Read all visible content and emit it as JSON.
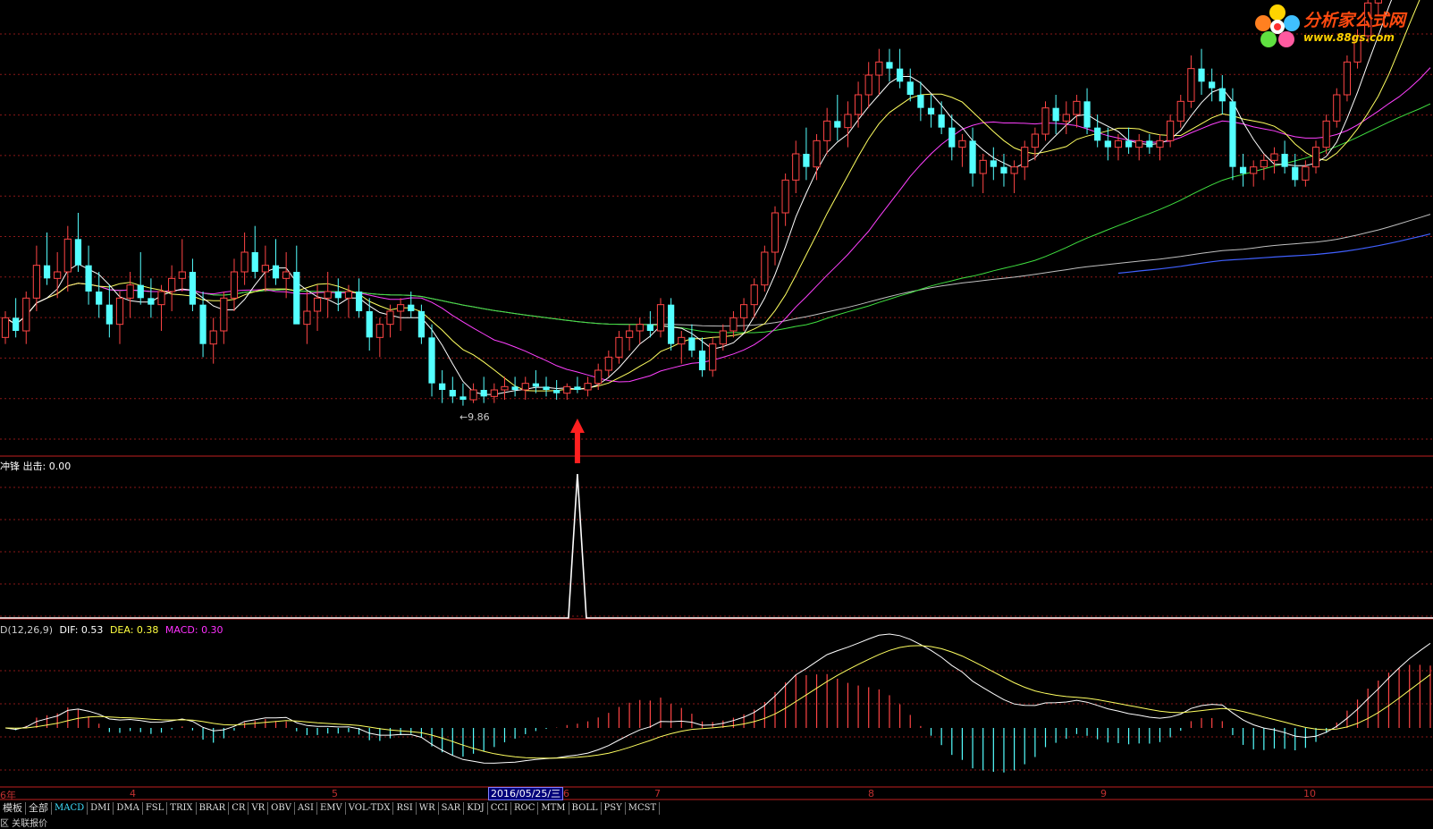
{
  "colors": {
    "up": "#ff4545",
    "down": "#54ffff",
    "ma5": "#ffffff",
    "ma10": "#ffff60",
    "ma20": "#ff40ff",
    "ma60": "#40e040",
    "ma120": "#c0c0c0",
    "ma250": "#4060ff",
    "grid": "#8a1818",
    "border": "#c02020",
    "signal": "#ffffff",
    "arrow": "#ff2020"
  },
  "watermark": {
    "title": "分析家公式网",
    "url": "www.88gs.com",
    "logo_icon": "flower-logo-icon"
  },
  "main_chart": {
    "low_marker": "←9.86",
    "signal_icon": "up-arrow-icon"
  },
  "indicator": {
    "header": "冲锋 出击: 0.00"
  },
  "macd": {
    "name": "D(12,26,9)",
    "dif_label": "DIF: 0.53",
    "dea_label": "DEA: 0.38",
    "macd_label": "MACD: 0.30"
  },
  "x_axis": {
    "labels": [
      "6年",
      "4",
      "5",
      "6",
      "7",
      "8",
      "9",
      "10"
    ],
    "selected_date": "2016/05/25/三"
  },
  "tabs": [
    "模板",
    "全部",
    "MACD",
    "DMI",
    "DMA",
    "FSL",
    "TRIX",
    "BRAR",
    "CR",
    "VR",
    "OBV",
    "ASI",
    "EMV",
    "VOL-TDX",
    "RSI",
    "WR",
    "SAR",
    "KDJ",
    "CCI",
    "ROC",
    "MTM",
    "BOLL",
    "PSY",
    "MCST"
  ],
  "active_tab": "MACD",
  "footer_text": "区  关联报价",
  "chart_data": {
    "type": "candlestick",
    "series": [
      {
        "values": [
          [
            10.9,
            11.3,
            10.8,
            11.2
          ],
          [
            11.2,
            11.5,
            10.9,
            11.0
          ],
          [
            11.0,
            11.6,
            10.8,
            11.5
          ],
          [
            11.5,
            12.3,
            11.3,
            12.0
          ],
          [
            12.0,
            12.5,
            11.7,
            11.8
          ],
          [
            11.8,
            12.2,
            11.5,
            11.9
          ],
          [
            11.9,
            12.6,
            11.6,
            12.4
          ],
          [
            12.4,
            12.8,
            11.9,
            12.0
          ],
          [
            12.0,
            12.3,
            11.4,
            11.6
          ],
          [
            11.6,
            11.9,
            11.2,
            11.4
          ],
          [
            11.4,
            11.7,
            10.9,
            11.1
          ],
          [
            11.1,
            11.6,
            10.8,
            11.5
          ],
          [
            11.5,
            11.9,
            11.2,
            11.7
          ],
          [
            11.7,
            12.2,
            11.4,
            11.5
          ],
          [
            11.5,
            11.8,
            11.2,
            11.4
          ],
          [
            11.4,
            11.7,
            11.0,
            11.6
          ],
          [
            11.6,
            12.0,
            11.3,
            11.8
          ],
          [
            11.8,
            12.4,
            11.6,
            11.9
          ],
          [
            11.9,
            12.1,
            11.3,
            11.4
          ],
          [
            11.4,
            11.6,
            10.6,
            10.8
          ],
          [
            10.8,
            11.2,
            10.5,
            11.0
          ],
          [
            11.0,
            11.6,
            10.8,
            11.5
          ],
          [
            11.5,
            12.1,
            11.3,
            11.9
          ],
          [
            11.9,
            12.5,
            11.7,
            12.2
          ],
          [
            12.2,
            12.6,
            11.8,
            11.9
          ],
          [
            11.9,
            12.3,
            11.6,
            12.0
          ],
          [
            12.0,
            12.4,
            11.7,
            11.8
          ],
          [
            11.8,
            12.2,
            11.5,
            11.9
          ],
          [
            11.9,
            12.3,
            11.6,
            11.1
          ],
          [
            11.1,
            11.6,
            10.8,
            11.3
          ],
          [
            11.3,
            11.7,
            11.0,
            11.5
          ],
          [
            11.5,
            11.9,
            11.2,
            11.6
          ],
          [
            11.6,
            11.8,
            11.3,
            11.5
          ],
          [
            11.5,
            11.7,
            11.2,
            11.6
          ],
          [
            11.6,
            11.8,
            11.2,
            11.3
          ],
          [
            11.3,
            11.5,
            10.7,
            10.9
          ],
          [
            10.9,
            11.2,
            10.6,
            11.1
          ],
          [
            11.1,
            11.4,
            10.9,
            11.3
          ],
          [
            11.3,
            11.5,
            11.0,
            11.4
          ],
          [
            11.4,
            11.6,
            11.2,
            11.3
          ],
          [
            11.3,
            11.4,
            10.8,
            10.9
          ],
          [
            10.9,
            11.1,
            10.0,
            10.2
          ],
          [
            10.2,
            10.4,
            9.9,
            10.1
          ],
          [
            10.1,
            10.3,
            9.9,
            10.0
          ],
          [
            10.0,
            10.2,
            9.86,
            9.95
          ],
          [
            9.95,
            10.2,
            9.9,
            10.1
          ],
          [
            10.1,
            10.3,
            9.9,
            10.0
          ],
          [
            10.0,
            10.2,
            9.9,
            10.1
          ],
          [
            10.1,
            10.3,
            9.95,
            10.15
          ],
          [
            10.15,
            10.3,
            10.0,
            10.1
          ],
          [
            10.1,
            10.3,
            9.95,
            10.2
          ],
          [
            10.2,
            10.4,
            10.05,
            10.15
          ],
          [
            10.15,
            10.3,
            10.0,
            10.1
          ],
          [
            10.1,
            10.25,
            9.95,
            10.05
          ],
          [
            10.05,
            10.2,
            9.95,
            10.15
          ],
          [
            10.15,
            10.3,
            10.05,
            10.1
          ],
          [
            10.1,
            10.3,
            10.0,
            10.2
          ],
          [
            10.2,
            10.5,
            10.1,
            10.4
          ],
          [
            10.4,
            10.7,
            10.3,
            10.6
          ],
          [
            10.6,
            11.0,
            10.5,
            10.9
          ],
          [
            10.9,
            11.1,
            10.7,
            11.0
          ],
          [
            11.0,
            11.2,
            10.8,
            11.1
          ],
          [
            11.1,
            11.3,
            10.9,
            11.0
          ],
          [
            11.0,
            11.5,
            10.9,
            11.4
          ],
          [
            11.4,
            11.5,
            10.7,
            10.8
          ],
          [
            10.8,
            11.0,
            10.5,
            10.9
          ],
          [
            10.9,
            11.1,
            10.6,
            10.7
          ],
          [
            10.7,
            10.9,
            10.3,
            10.4
          ],
          [
            10.4,
            10.9,
            10.3,
            10.8
          ],
          [
            10.8,
            11.1,
            10.7,
            11.0
          ],
          [
            11.0,
            11.3,
            10.9,
            11.2
          ],
          [
            11.2,
            11.5,
            11.0,
            11.4
          ],
          [
            11.4,
            11.8,
            11.2,
            11.7
          ],
          [
            11.7,
            12.3,
            11.6,
            12.2
          ],
          [
            12.2,
            12.9,
            12.0,
            12.8
          ],
          [
            12.8,
            13.4,
            12.6,
            13.3
          ],
          [
            13.3,
            13.9,
            13.1,
            13.7
          ],
          [
            13.7,
            14.1,
            13.3,
            13.5
          ],
          [
            13.5,
            14.0,
            13.3,
            13.9
          ],
          [
            13.9,
            14.4,
            13.7,
            14.2
          ],
          [
            14.2,
            14.6,
            13.9,
            14.1
          ],
          [
            14.1,
            14.5,
            13.8,
            14.3
          ],
          [
            14.3,
            14.8,
            14.1,
            14.6
          ],
          [
            14.6,
            15.1,
            14.4,
            14.9
          ],
          [
            14.9,
            15.3,
            14.6,
            15.1
          ],
          [
            15.1,
            15.3,
            14.8,
            15.0
          ],
          [
            15.0,
            15.3,
            14.7,
            14.8
          ],
          [
            14.8,
            15.0,
            14.5,
            14.6
          ],
          [
            14.6,
            14.8,
            14.2,
            14.4
          ],
          [
            14.4,
            14.6,
            14.1,
            14.3
          ],
          [
            14.3,
            14.5,
            14.0,
            14.1
          ],
          [
            14.1,
            14.3,
            13.6,
            13.8
          ],
          [
            13.8,
            14.0,
            13.5,
            13.9
          ],
          [
            13.9,
            14.1,
            13.2,
            13.4
          ],
          [
            13.4,
            13.7,
            13.1,
            13.6
          ],
          [
            13.6,
            13.8,
            13.3,
            13.5
          ],
          [
            13.5,
            13.7,
            13.2,
            13.4
          ],
          [
            13.4,
            13.6,
            13.1,
            13.5
          ],
          [
            13.5,
            13.9,
            13.3,
            13.8
          ],
          [
            13.8,
            14.1,
            13.6,
            14.0
          ],
          [
            14.0,
            14.5,
            13.9,
            14.4
          ],
          [
            14.4,
            14.6,
            14.0,
            14.2
          ],
          [
            14.2,
            14.5,
            14.0,
            14.3
          ],
          [
            14.3,
            14.6,
            14.1,
            14.5
          ],
          [
            14.5,
            14.7,
            14.0,
            14.1
          ],
          [
            14.1,
            14.3,
            13.8,
            13.9
          ],
          [
            13.9,
            14.1,
            13.6,
            13.8
          ],
          [
            13.8,
            14.0,
            13.6,
            13.9
          ],
          [
            13.9,
            14.1,
            13.7,
            13.8
          ],
          [
            13.8,
            14.0,
            13.6,
            13.9
          ],
          [
            13.9,
            14.0,
            13.7,
            13.8
          ],
          [
            13.8,
            14.0,
            13.6,
            13.9
          ],
          [
            13.9,
            14.3,
            13.8,
            14.2
          ],
          [
            14.2,
            14.6,
            14.1,
            14.5
          ],
          [
            14.5,
            15.2,
            14.4,
            15.0
          ],
          [
            15.0,
            15.3,
            14.6,
            14.8
          ],
          [
            14.8,
            15.0,
            14.5,
            14.7
          ],
          [
            14.7,
            14.9,
            14.3,
            14.5
          ],
          [
            14.5,
            14.7,
            13.3,
            13.5
          ],
          [
            13.5,
            13.7,
            13.2,
            13.4
          ],
          [
            13.4,
            13.6,
            13.2,
            13.5
          ],
          [
            13.5,
            13.7,
            13.3,
            13.6
          ],
          [
            13.6,
            13.8,
            13.4,
            13.7
          ],
          [
            13.7,
            13.9,
            13.4,
            13.5
          ],
          [
            13.5,
            13.7,
            13.2,
            13.3
          ],
          [
            13.3,
            13.6,
            13.2,
            13.5
          ],
          [
            13.5,
            13.9,
            13.4,
            13.8
          ],
          [
            13.8,
            14.3,
            13.7,
            14.2
          ],
          [
            14.2,
            14.7,
            14.1,
            14.6
          ],
          [
            14.6,
            15.2,
            14.5,
            15.1
          ],
          [
            15.1,
            15.6,
            15.0,
            15.5
          ],
          [
            15.5,
            16.1,
            15.4,
            16.0
          ],
          [
            16.0,
            16.5,
            15.8,
            16.3
          ],
          [
            16.3,
            16.9,
            16.1,
            16.8
          ],
          [
            16.8,
            17.3,
            16.6,
            17.1
          ],
          [
            17.1,
            17.6,
            16.9,
            17.4
          ],
          [
            17.4,
            17.8,
            17.1,
            17.6
          ],
          [
            17.6,
            18.0,
            17.3,
            17.9
          ]
        ]
      }
    ],
    "ylim": [
      9.5,
      15.5
    ],
    "signal_index": 55,
    "grid": true
  }
}
